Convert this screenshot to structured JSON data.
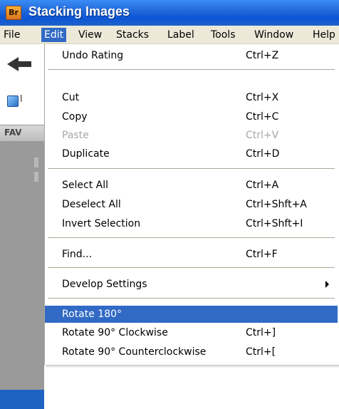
{
  "window": {
    "app_icon_text": "Br",
    "title": "Stacking Images"
  },
  "menubar": {
    "items": [
      {
        "label": "File"
      },
      {
        "label": "Edit"
      },
      {
        "label": "View"
      },
      {
        "label": "Stacks"
      },
      {
        "label": "Label"
      },
      {
        "label": "Tools"
      },
      {
        "label": "Window"
      },
      {
        "label": "Help"
      }
    ],
    "active": "Edit"
  },
  "background": {
    "toolbar_label_fragment": "l",
    "favorites_label": "FAV"
  },
  "edit_menu": {
    "items": [
      {
        "label": "Undo Rating",
        "shortcut": "Ctrl+Z"
      },
      {
        "label": "Cut",
        "shortcut": "Ctrl+X"
      },
      {
        "label": "Copy",
        "shortcut": "Ctrl+C"
      },
      {
        "label": "Paste",
        "shortcut": "Ctrl+V",
        "disabled": true
      },
      {
        "label": "Duplicate",
        "shortcut": "Ctrl+D"
      },
      {
        "label": "Select All",
        "shortcut": "Ctrl+A"
      },
      {
        "label": "Deselect All",
        "shortcut": "Ctrl+Shft+A"
      },
      {
        "label": "Invert Selection",
        "shortcut": "Ctrl+Shft+I"
      },
      {
        "label": "Find...",
        "shortcut": "Ctrl+F"
      },
      {
        "label": "Develop Settings",
        "shortcut": "",
        "submenu": true
      },
      {
        "label": "Rotate 180°",
        "shortcut": "",
        "highlighted": true
      },
      {
        "label": "Rotate 90° Clockwise",
        "shortcut": "Ctrl+]"
      },
      {
        "label": "Rotate 90° Counterclockwise",
        "shortcut": "Ctrl+["
      }
    ]
  },
  "colors": {
    "title_bar": "#0b56d6",
    "menu_highlight": "#316ac5",
    "menubar_bg": "#ece9d8",
    "disabled_text": "#a8a8a8"
  }
}
